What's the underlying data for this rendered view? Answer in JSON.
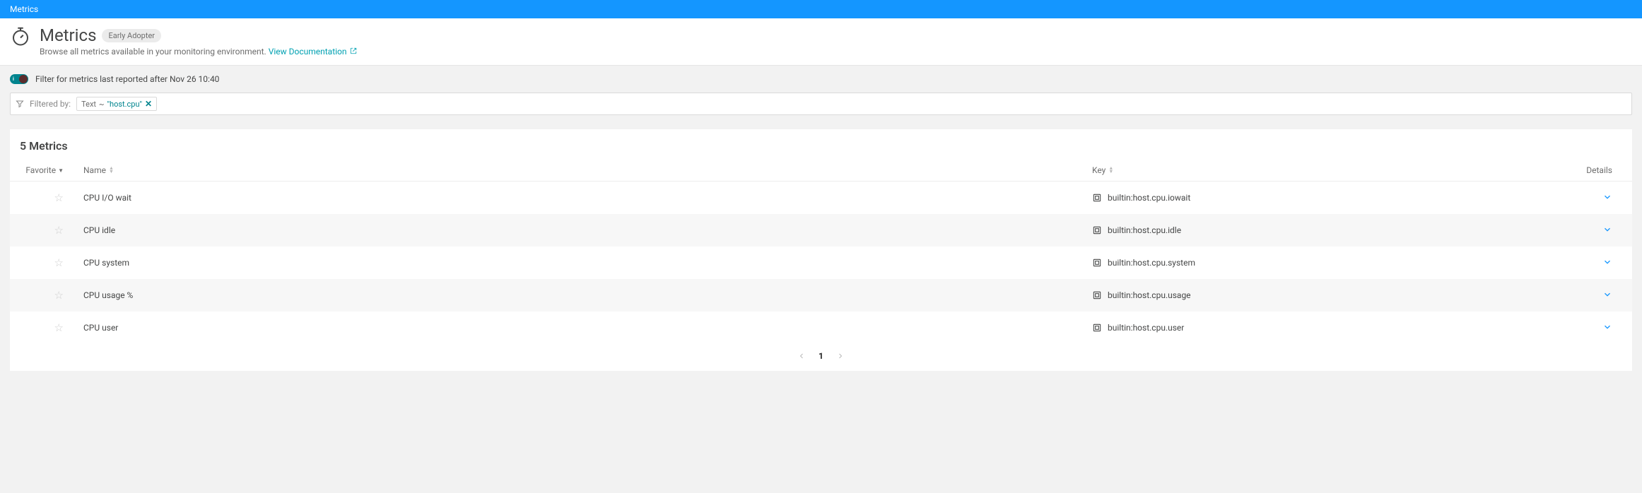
{
  "breadcrumb": "Metrics",
  "header": {
    "title": "Metrics",
    "badge": "Early Adopter",
    "subtitle": "Browse all metrics available in your monitoring environment.",
    "doc_link": "View Documentation"
  },
  "toggle_filter": {
    "label": "Filter for metrics last reported after Nov 26 10:40"
  },
  "filter_bar": {
    "label": "Filtered by:",
    "chip_type": "Text",
    "chip_sep": "~",
    "chip_value": "\"host.cpu\""
  },
  "results": {
    "heading": "5 Metrics",
    "columns": {
      "favorite": "Favorite",
      "name": "Name",
      "key": "Key",
      "details": "Details"
    },
    "rows": [
      {
        "name": "CPU I/O wait",
        "key": "builtin:host.cpu.iowait"
      },
      {
        "name": "CPU idle",
        "key": "builtin:host.cpu.idle"
      },
      {
        "name": "CPU system",
        "key": "builtin:host.cpu.system"
      },
      {
        "name": "CPU usage %",
        "key": "builtin:host.cpu.usage"
      },
      {
        "name": "CPU user",
        "key": "builtin:host.cpu.user"
      }
    ]
  },
  "pagination": {
    "current": "1"
  }
}
